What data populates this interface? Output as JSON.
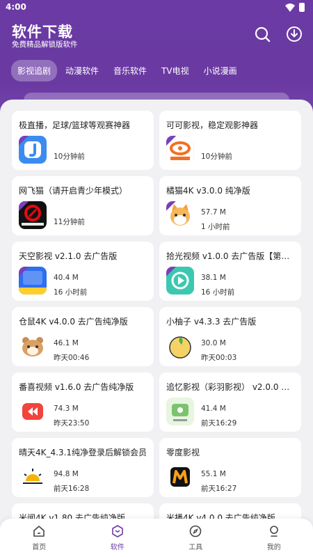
{
  "status": {
    "time": "4:00"
  },
  "header": {
    "title": "软件下载",
    "subtitle": "免费精品解锁版软件",
    "search_icon": "search-icon",
    "download_icon": "download-icon"
  },
  "tabs": [
    {
      "label": "影视追剧",
      "active": true
    },
    {
      "label": "动漫软件",
      "active": false
    },
    {
      "label": "音乐软件",
      "active": false
    },
    {
      "label": "TV电视",
      "active": false
    },
    {
      "label": "小说漫画",
      "active": false
    }
  ],
  "apps": [
    {
      "name": "极直播，足球/篮球等观赛神器",
      "size": "",
      "time": "10分钟前",
      "icon": "jizhibo-icon"
    },
    {
      "name": "可可影视，稳定观影神器",
      "size": "",
      "time": "10分钟前",
      "icon": "kekeys-icon"
    },
    {
      "name": "网飞猫（请开启青少年模式）",
      "size": "",
      "time": "11分钟前",
      "icon": "ncat-icon"
    },
    {
      "name": "橘猫4K v3.0.0 纯净版",
      "size": "57.7 M",
      "time": "1 小时前",
      "icon": "cat-icon"
    },
    {
      "name": "天空影视 v2.1.0 去广告版",
      "size": "40.4 M",
      "time": "16 小时前",
      "icon": "tiankong-icon"
    },
    {
      "name": "拾光视频 v1.0.0 去广告版【第一…",
      "size": "38.1 M",
      "time": "16 小时前",
      "icon": "play-icon"
    },
    {
      "name": "仓鼠4K v4.0.0 去广告纯净版",
      "size": "46.1 M",
      "time": "昨天00:46",
      "icon": "hamster-icon"
    },
    {
      "name": "小柚子 v4.3.3 去广告版",
      "size": "30.0 M",
      "time": "昨天00:03",
      "icon": "pomelo-icon"
    },
    {
      "name": "番喜视频 v1.6.0 去广告纯净版",
      "size": "74.3 M",
      "time": "昨天23:50",
      "icon": "fanxi-icon"
    },
    {
      "name": "追忆影视（彩羽影视） v2.0.0 纯…",
      "size": "41.4 M",
      "time": "前天16:29",
      "icon": "zhuiyi-icon"
    },
    {
      "name": "晴天4K_4.3.1纯净登录后解锁会员",
      "size": "94.8 M",
      "time": "前天16:28",
      "icon": "sun-icon"
    },
    {
      "name": "零度影视",
      "size": "55.1 M",
      "time": "前天16:27",
      "icon": "m-icon"
    },
    {
      "name": "米闻4K v1.80 去广告纯净版",
      "size": "",
      "time": "",
      "icon": "app-icon"
    },
    {
      "name": "米播4K v4.0.0 去广告纯净版",
      "size": "",
      "time": "",
      "icon": "app-icon"
    }
  ],
  "bottom_nav": [
    {
      "label": "首页",
      "icon": "home-icon",
      "active": false
    },
    {
      "label": "软件",
      "icon": "box-icon",
      "active": true
    },
    {
      "label": "工具",
      "icon": "compass-icon",
      "active": false
    },
    {
      "label": "我的",
      "icon": "user-icon",
      "active": false
    }
  ],
  "colors": {
    "accent": "#6b3aa4",
    "background": "#f1f1f4"
  }
}
